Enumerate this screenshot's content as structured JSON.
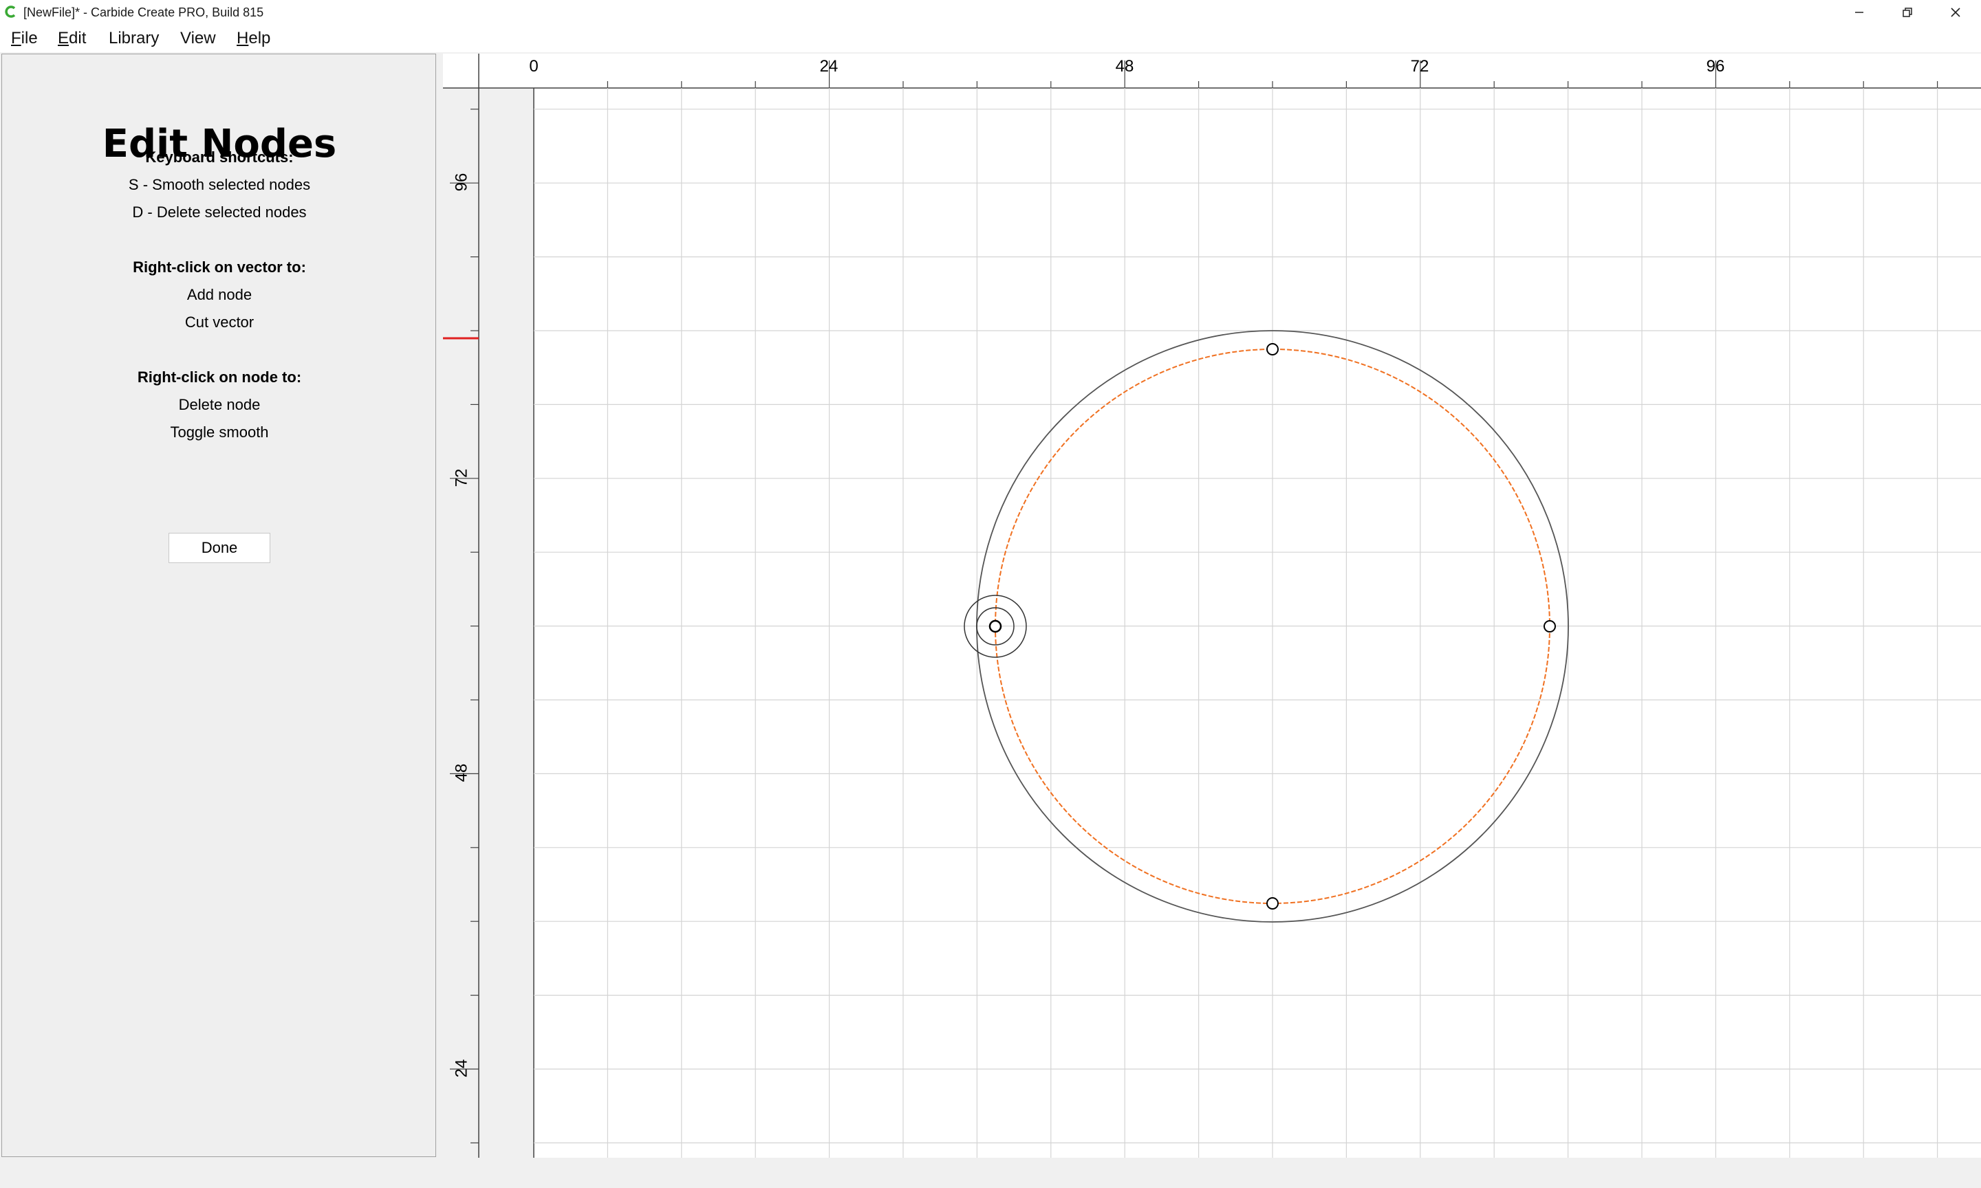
{
  "window": {
    "title": "[NewFile]* - Carbide Create PRO, Build 815",
    "app_icon": "carbide-c-icon",
    "controls": {
      "minimize_icon": "minimize-icon",
      "restore_icon": "restore-icon",
      "close_icon": "close-icon"
    }
  },
  "menu": {
    "items": [
      {
        "mnemonic": "F",
        "rest": "ile"
      },
      {
        "mnemonic": "E",
        "rest": "dit"
      },
      {
        "mnemonic": "",
        "rest": "Library"
      },
      {
        "mnemonic": "",
        "rest": "View"
      },
      {
        "mnemonic": "H",
        "rest": "elp"
      }
    ]
  },
  "panel": {
    "title": "Edit Nodes",
    "keyboard_heading": "Keyboard shortcuts:",
    "shortcut_smooth": "S - Smooth selected nodes",
    "shortcut_delete": "D - Delete selected nodes",
    "vector_heading": "Right-click on vector to:",
    "vector_add_node": "Add node",
    "vector_cut": "Cut vector",
    "node_heading": "Right-click on node to:",
    "node_delete": "Delete node",
    "node_toggle_smooth": "Toggle smooth",
    "done_label": "Done"
  },
  "rulers": {
    "top_labels": [
      "0",
      "24",
      "48",
      "72",
      "96"
    ],
    "left_labels": [
      "96",
      "72",
      "48",
      "24"
    ]
  },
  "colors": {
    "toolpath_orange": "#f07020",
    "vector_outline": "#555555",
    "grid": "#d4d4d4",
    "ruler_marker_red": "#e02020"
  }
}
